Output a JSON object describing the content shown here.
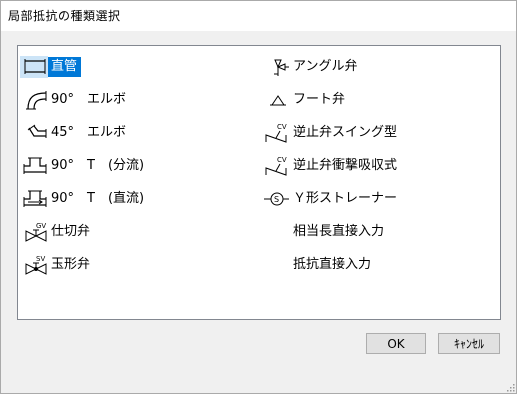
{
  "window": {
    "title": "局部抵抗の種類選択"
  },
  "list": {
    "left_column": [
      {
        "label": "直管",
        "icon": "straight-pipe-icon",
        "selected": true
      },
      {
        "label": "90°　エルボ",
        "icon": "elbow-90-icon"
      },
      {
        "label": "45°　エルボ",
        "icon": "elbow-45-icon"
      },
      {
        "label": "90°　T　(分流)",
        "icon": "tee-branch-icon"
      },
      {
        "label": "90°　T　(直流)",
        "icon": "tee-straight-icon"
      },
      {
        "label": "仕切弁",
        "icon": "gate-valve-icon",
        "icon_text": "GV"
      },
      {
        "label": "玉形弁",
        "icon": "globe-valve-icon",
        "icon_text": "SV"
      }
    ],
    "right_column": [
      {
        "label": "アングル弁",
        "icon": "angle-valve-icon"
      },
      {
        "label": "フート弁",
        "icon": "foot-valve-icon"
      },
      {
        "label": "逆止弁スイング型",
        "icon": "swing-check-valve-icon",
        "icon_text": "CV"
      },
      {
        "label": "逆止弁衝撃吸収式",
        "icon": "shock-check-valve-icon",
        "icon_text": "CV"
      },
      {
        "label": "Ｙ形ストレーナー",
        "icon": "y-strainer-icon",
        "icon_text": "S"
      },
      {
        "label": "相当長直接入力",
        "icon": ""
      },
      {
        "label": "抵抗直接入力",
        "icon": ""
      }
    ]
  },
  "buttons": {
    "ok": "OK",
    "cancel": "ｷｬﾝｾﾙ"
  },
  "colors": {
    "selection": "#0078d7",
    "selection_icon_bg": "#cce4f7"
  }
}
